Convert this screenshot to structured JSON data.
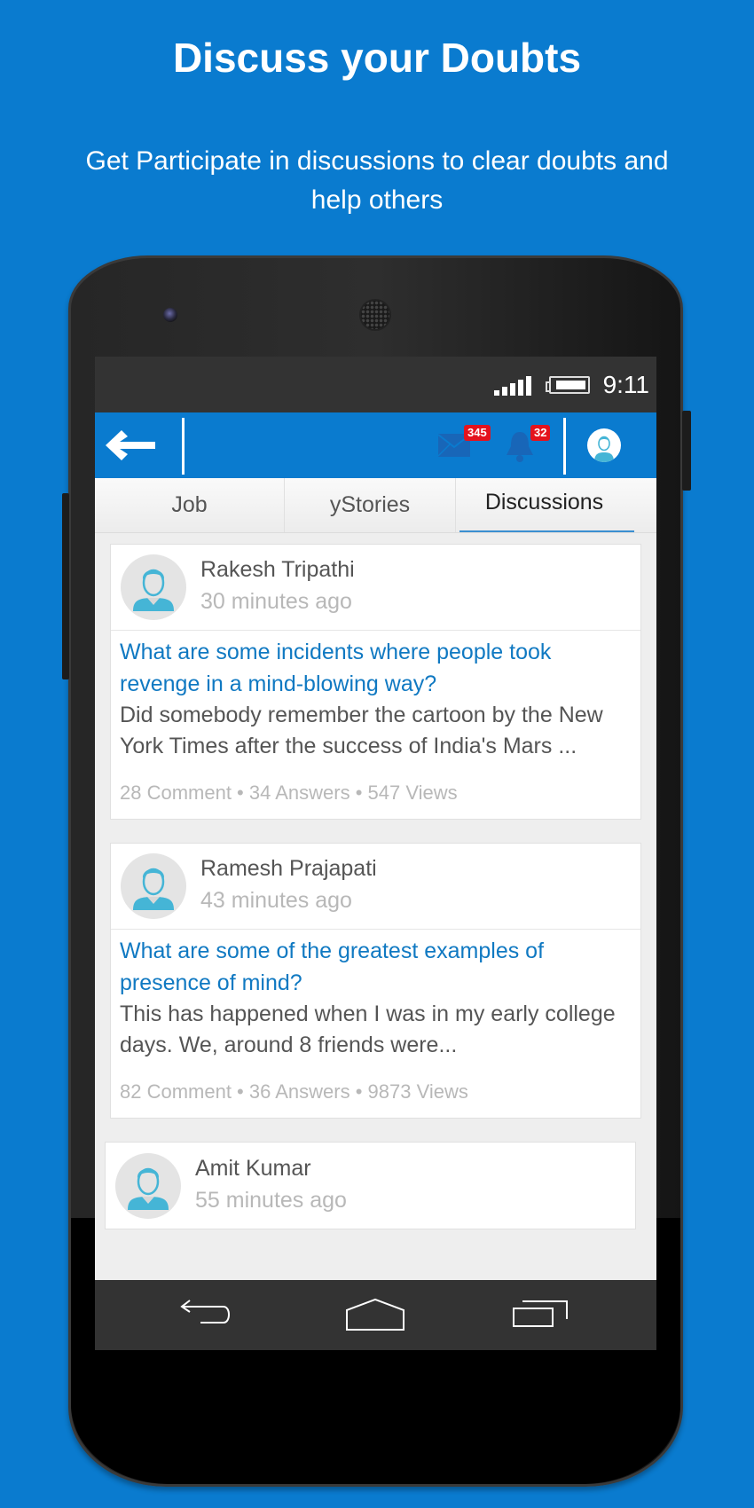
{
  "hero": {
    "title": "Discuss your Doubts",
    "subtitle": "Get Participate in discussions to clear doubts and help others"
  },
  "status_bar": {
    "time": "9:11",
    "signal_icon": "signal-bars-icon",
    "battery_icon": "battery-icon"
  },
  "app_bar": {
    "back_icon": "arrow-left-icon",
    "mail_icon": "envelope-icon",
    "mail_badge": "345",
    "notification_icon": "bell-icon",
    "notification_badge": "32",
    "profile_icon": "user-avatar-icon",
    "accent_color": "#0a7bcf",
    "badge_color": "#e4131d"
  },
  "tabs": [
    {
      "label": "Job",
      "active": false
    },
    {
      "label": "yStories",
      "active": false
    },
    {
      "label": "Discussions",
      "active": true
    }
  ],
  "discussions": [
    {
      "author": "Rakesh Tripathi",
      "time": "30 minutes ago",
      "question": "What are some incidents where people took revenge in a mind-blowing way?",
      "excerpt": "Did somebody remember the cartoon by the New York Times after the success of India's Mars ...",
      "stats": "28 Comment • 34 Answers • 547 Views"
    },
    {
      "author": "Ramesh Prajapati",
      "time": "43 minutes ago",
      "question": "What are some of the greatest examples of presence of mind?",
      "excerpt": "This has happened when I was in my early college days. We, around 8 friends were...",
      "stats": "82 Comment • 36 Answers • 9873 Views"
    },
    {
      "author": "Amit Kumar",
      "time": "55 minutes ago"
    }
  ],
  "nav_bar": {
    "back": "nav-back-icon",
    "home": "nav-home-icon",
    "recents": "nav-recents-icon"
  },
  "colors": {
    "background": "#0a7bcf",
    "question_link": "#1079c2",
    "avatar_figure": "#45b5d6"
  }
}
